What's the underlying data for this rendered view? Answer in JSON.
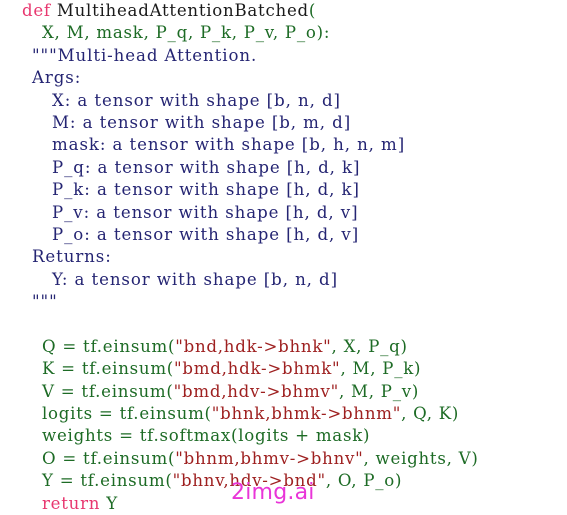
{
  "listing": {
    "language": "python",
    "background_color": "#ffffff",
    "colors": {
      "keyword": "#e8376f",
      "function_name": "#1a1a1a",
      "code": "#1d6b25",
      "docstring": "#252573",
      "string": "#9e2020",
      "watermark": "#e935d8"
    },
    "lines": [
      {
        "id": "line-def",
        "indent": "ind0",
        "kind": "code",
        "tokens": [
          {
            "cls": "tok-kw",
            "text": "def"
          },
          {
            "cls": "tok-plain",
            "text": " "
          },
          {
            "cls": "tok-fname",
            "text": "MultiheadAttentionBatched"
          },
          {
            "cls": "tok-code",
            "text": "("
          }
        ]
      },
      {
        "id": "line-params",
        "indent": "ind1",
        "kind": "code",
        "tokens": [
          {
            "cls": "tok-code",
            "text": "X, M, mask, P_q, P_k, P_v, P_o):"
          }
        ]
      },
      {
        "id": "line-doc-open",
        "indent": "ind2",
        "kind": "doc",
        "tokens": [
          {
            "cls": "tok-doc",
            "text": "\"\"\"Multi-head Attention."
          }
        ]
      },
      {
        "id": "line-doc-args",
        "indent": "ind2",
        "kind": "doc",
        "tokens": [
          {
            "cls": "tok-doc",
            "text": "Args:"
          }
        ]
      },
      {
        "id": "line-doc-x",
        "indent": "ind3",
        "kind": "doc",
        "tokens": [
          {
            "cls": "tok-doc",
            "text": "X: a tensor with shape [b, n, d]"
          }
        ]
      },
      {
        "id": "line-doc-m",
        "indent": "ind3",
        "kind": "doc",
        "tokens": [
          {
            "cls": "tok-doc",
            "text": "M: a tensor with shape [b, m, d]"
          }
        ]
      },
      {
        "id": "line-doc-mask",
        "indent": "ind3",
        "kind": "doc",
        "tokens": [
          {
            "cls": "tok-doc",
            "text": "mask: a tensor with shape [b, h, n, m]"
          }
        ]
      },
      {
        "id": "line-doc-pq",
        "indent": "ind3",
        "kind": "doc",
        "tokens": [
          {
            "cls": "tok-doc",
            "text": "P_q: a tensor with shape [h, d, k]"
          }
        ]
      },
      {
        "id": "line-doc-pk",
        "indent": "ind3",
        "kind": "doc",
        "tokens": [
          {
            "cls": "tok-doc",
            "text": "P_k: a tensor with shape [h, d, k]"
          }
        ]
      },
      {
        "id": "line-doc-pv",
        "indent": "ind3",
        "kind": "doc",
        "tokens": [
          {
            "cls": "tok-doc",
            "text": "P_v: a tensor with shape [h, d, v]"
          }
        ]
      },
      {
        "id": "line-doc-po",
        "indent": "ind3",
        "kind": "doc",
        "tokens": [
          {
            "cls": "tok-doc",
            "text": "P_o: a tensor with shape [h, d, v]"
          }
        ]
      },
      {
        "id": "line-doc-returns",
        "indent": "ind2",
        "kind": "doc",
        "tokens": [
          {
            "cls": "tok-doc",
            "text": "Returns:"
          }
        ]
      },
      {
        "id": "line-doc-y",
        "indent": "ind3",
        "kind": "doc",
        "tokens": [
          {
            "cls": "tok-doc",
            "text": "Y: a tensor with shape [b, n, d]"
          }
        ]
      },
      {
        "id": "line-doc-close",
        "indent": "ind2",
        "kind": "doc",
        "tokens": [
          {
            "cls": "tok-doc",
            "text": "\"\"\""
          }
        ]
      },
      {
        "id": "line-blank",
        "indent": "ind2",
        "kind": "blank",
        "tokens": []
      },
      {
        "id": "line-q",
        "indent": "ind4",
        "kind": "code",
        "tokens": [
          {
            "cls": "tok-code",
            "text": "Q = tf.einsum("
          },
          {
            "cls": "tok-str",
            "text": "\"bnd,hdk->bhnk\""
          },
          {
            "cls": "tok-code",
            "text": ", X, P_q)"
          }
        ]
      },
      {
        "id": "line-k",
        "indent": "ind4",
        "kind": "code",
        "tokens": [
          {
            "cls": "tok-code",
            "text": "K = tf.einsum("
          },
          {
            "cls": "tok-str",
            "text": "\"bmd,hdk->bhmk\""
          },
          {
            "cls": "tok-code",
            "text": ", M, P_k)"
          }
        ]
      },
      {
        "id": "line-v",
        "indent": "ind4",
        "kind": "code",
        "tokens": [
          {
            "cls": "tok-code",
            "text": "V = tf.einsum("
          },
          {
            "cls": "tok-str",
            "text": "\"bmd,hdv->bhmv\""
          },
          {
            "cls": "tok-code",
            "text": ", M, P_v)"
          }
        ]
      },
      {
        "id": "line-logits",
        "indent": "ind4",
        "kind": "code",
        "tokens": [
          {
            "cls": "tok-code",
            "text": "logits = tf.einsum("
          },
          {
            "cls": "tok-str",
            "text": "\"bhnk,bhmk->bhnm\""
          },
          {
            "cls": "tok-code",
            "text": ", Q, K)"
          }
        ]
      },
      {
        "id": "line-weights",
        "indent": "ind4",
        "kind": "code",
        "tokens": [
          {
            "cls": "tok-code",
            "text": "weights = tf.softmax(logits + mask)"
          }
        ]
      },
      {
        "id": "line-o",
        "indent": "ind4",
        "kind": "code",
        "tokens": [
          {
            "cls": "tok-code",
            "text": "O = tf.einsum("
          },
          {
            "cls": "tok-str",
            "text": "\"bhnm,bhmv->bhnv\""
          },
          {
            "cls": "tok-code",
            "text": ", weights, V)"
          }
        ]
      },
      {
        "id": "line-y",
        "indent": "ind4",
        "kind": "code",
        "tokens": [
          {
            "cls": "tok-code",
            "text": "Y = tf.einsum("
          },
          {
            "cls": "tok-str",
            "text": "\"bhnv,hdv->bnd\""
          },
          {
            "cls": "tok-code",
            "text": ", O, P_o)"
          }
        ]
      },
      {
        "id": "line-return",
        "indent": "ind4",
        "kind": "code",
        "tokens": [
          {
            "cls": "tok-kw",
            "text": "return"
          },
          {
            "cls": "tok-code",
            "text": " Y"
          }
        ]
      }
    ]
  },
  "watermark": {
    "text": "2img.ai"
  }
}
